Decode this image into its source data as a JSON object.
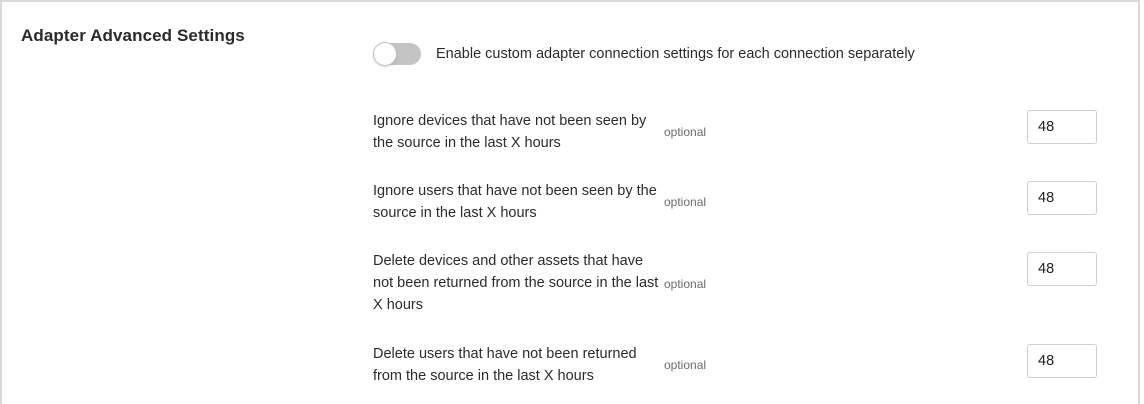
{
  "section": {
    "title": "Adapter Advanced Settings"
  },
  "toggle": {
    "label": "Enable custom adapter connection settings for each connection separately",
    "enabled": false
  },
  "settings": [
    {
      "label": "Ignore devices that have not been seen by the source in the last X hours",
      "optional": "optional",
      "value": "48"
    },
    {
      "label": "Ignore users that have not been seen by the source in the last X hours",
      "optional": "optional",
      "value": "48"
    },
    {
      "label": "Delete devices and other assets that have not been returned from the source in the last X hours",
      "optional": "optional",
      "value": "48"
    },
    {
      "label": "Delete users that have not been returned from the source in the last X hours",
      "optional": "optional",
      "value": "48"
    }
  ],
  "colors": {
    "toggle_off": "#c4c4c4",
    "border": "#d9d9d9",
    "optional_text": "#6b6b6b"
  }
}
